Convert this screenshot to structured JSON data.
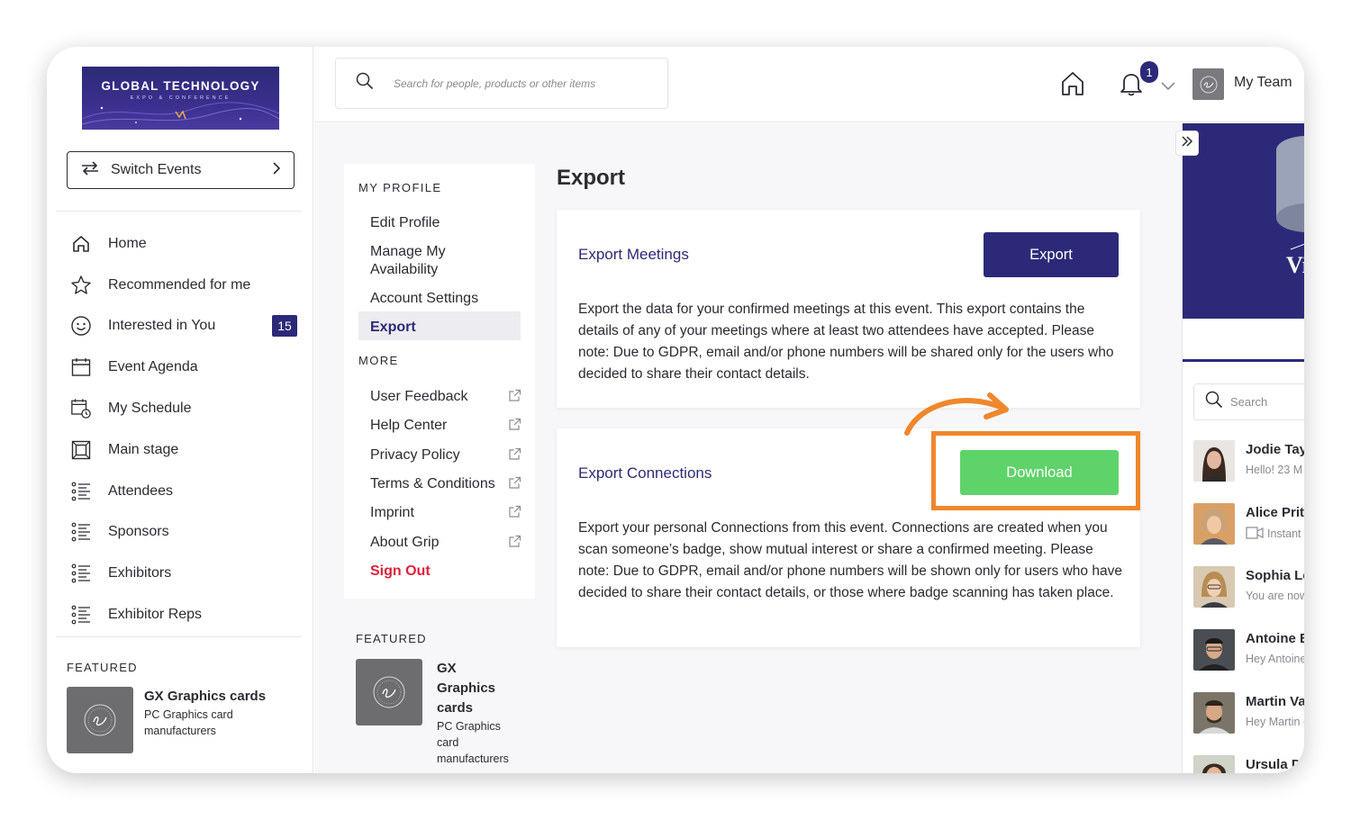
{
  "colors": {
    "brand": "#2c2a78",
    "download": "#5ed36a",
    "signout": "#e0203a",
    "highlight": "#f0872c"
  },
  "sidebar": {
    "logo": {
      "line1": "GLOBAL TECHNOLOGY",
      "line2": "EXPO & CONFERENCE"
    },
    "switch_label": "Switch Events",
    "nav": [
      {
        "label": "Home",
        "icon": "home-icon"
      },
      {
        "label": "Recommended for me",
        "icon": "star-icon"
      },
      {
        "label": "Interested in You",
        "icon": "smiley-icon",
        "badge": "15"
      },
      {
        "label": "Event Agenda",
        "icon": "calendar-icon"
      },
      {
        "label": "My Schedule",
        "icon": "schedule-icon"
      },
      {
        "label": "Main stage",
        "icon": "stage-icon"
      },
      {
        "label": "Attendees",
        "icon": "list-icon"
      },
      {
        "label": "Sponsors",
        "icon": "list-icon"
      },
      {
        "label": "Exhibitors",
        "icon": "list-icon"
      },
      {
        "label": "Exhibitor Reps",
        "icon": "list-icon"
      }
    ],
    "featured_label": "FEATURED",
    "featured": {
      "title": "GX Graphics cards",
      "subtitle": "PC Graphics card manufacturers"
    }
  },
  "topbar": {
    "search_placeholder": "Search for people, products or other items",
    "notification_count": "1",
    "team_label": "My Team"
  },
  "profile_menu": {
    "section1": "MY PROFILE",
    "items1": [
      "Edit Profile",
      "Manage My Availability",
      "Account Settings",
      "Export"
    ],
    "section2": "MORE",
    "items2": [
      "User Feedback",
      "Help Center",
      "Privacy Policy",
      "Terms & Conditions",
      "Imprint",
      "About Grip"
    ],
    "signout": "Sign Out",
    "featured_label": "FEATURED",
    "featured": {
      "title": "GX Graphics cards",
      "subtitle": "PC Graphics card manufacturers"
    }
  },
  "main": {
    "title": "Export",
    "meetings": {
      "title": "Export Meetings",
      "button": "Export",
      "text": "Export the data for your confirmed meetings at this event. This export contains the details of any of your meetings where at least two attendees have accepted. Please note: Due to GDPR, email and/or phone numbers will be shared only for the users who decided to share their contact details."
    },
    "connections": {
      "title": "Export Connections",
      "button": "Download",
      "text": "Export your personal Connections from this event. Connections are created when you scan someone’s badge, show mutual interest or share a confirmed meeting. Please note: Due to GDPR, email and/or phone numbers will be shown only for users who have decided to share their contact details, or those where badge scanning has taken place."
    }
  },
  "right_panel": {
    "banner_text": "Vi",
    "search_placeholder": "Search",
    "people": [
      {
        "name": "Jodie Tayl",
        "message": "Hello!  23 M"
      },
      {
        "name": "Alice Pritc",
        "message": "Instant"
      },
      {
        "name": "Sophia Lev",
        "message": "You are now"
      },
      {
        "name": "Antoine B",
        "message": "Hey Antoine"
      },
      {
        "name": "Martin Va",
        "message": "Hey Martin -"
      },
      {
        "name": "Ursula D",
        "message": ""
      }
    ]
  }
}
